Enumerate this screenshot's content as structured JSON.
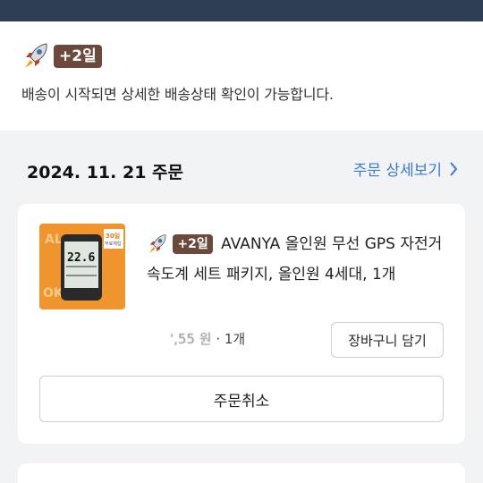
{
  "notice": {
    "badge": "+2일",
    "message": "배송이 시작되면 상세한 배송상태 확인이 가능합니다."
  },
  "order": {
    "date": "2024. 11. 21 주문",
    "detail_link": "주문 상세보기"
  },
  "item": {
    "badge": "+2일",
    "title": "AVANYA 올인원 무선 GPS 자전거 속도계 세트 패키지, 올인원 4세대, 1개",
    "price": "',55 원",
    "quantity": "· 1개",
    "thumb_label": "30일 무료체험",
    "thumb_value": "22.6",
    "cart_button": "장바구니 담기",
    "cancel_button": "주문취소"
  },
  "colors": {
    "header_bar": "#2d3e55",
    "badge_bg": "#6b4a3c",
    "link": "#3a7bd5",
    "thumb_orange": "#f0952e"
  }
}
